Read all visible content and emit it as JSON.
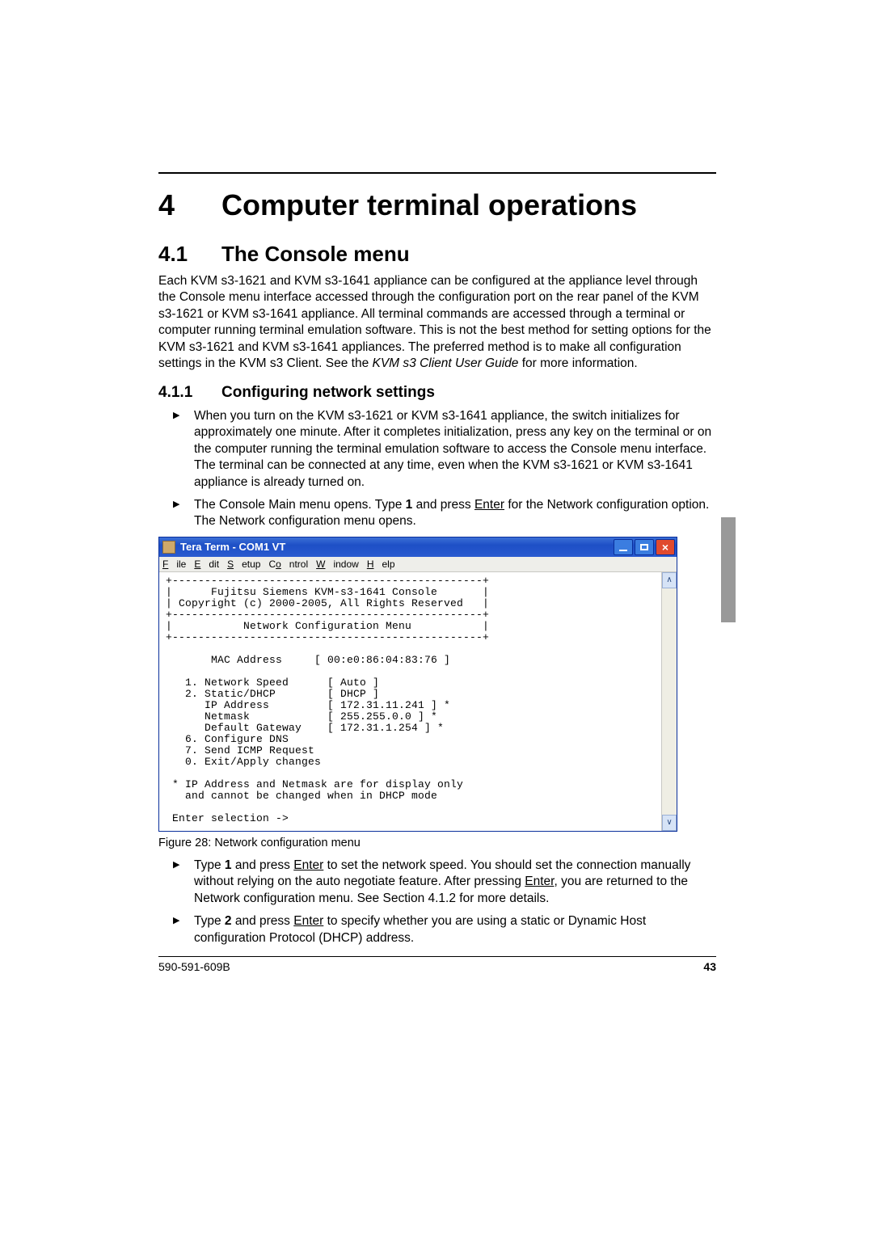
{
  "chapter": {
    "num": "4",
    "title": "Computer terminal operations"
  },
  "section": {
    "num": "4.1",
    "title": "The Console menu",
    "para": "Each KVM s3-1621 and KVM s3-1641 appliance can be configured at the appliance level through the Console menu interface accessed through the configuration port on the rear panel of the KVM s3-1621 or KVM s3-1641 appliance. All terminal commands are accessed through a terminal or computer running terminal emulation software. This is not the best method for setting options for the KVM s3-1621 and KVM s3-1641 appliances. The preferred method is to make all configuration settings in the KVM s3 Client. See the ",
    "para_em": "KVM s3 Client User Guide",
    "para_tail": " for more information."
  },
  "subsection": {
    "num": "4.1.1",
    "title": "Configuring network settings"
  },
  "bullets_top": [
    "When you turn on the KVM s3-1621 or KVM s3-1641 appliance, the switch initializes for approximately one minute. After it completes initialization, press any key on the terminal or on the computer running the terminal emulation software to access the Console menu interface. The terminal can be connected at any time, even when the KVM s3-1621 or KVM s3-1641 appliance is already turned on."
  ],
  "bullet_net": {
    "pre": "The Console Main menu opens. Type ",
    "b1": "1",
    "mid": " and press ",
    "u1": "Enter",
    "tail": " for the Network configuration option. The Network configuration menu opens."
  },
  "terminal": {
    "title": "Tera Term - COM1 VT",
    "menu": {
      "file": "File",
      "edit": "Edit",
      "setup": "Setup",
      "control": "Control",
      "window": "Window",
      "help": "Help"
    },
    "lines": [
      "+------------------------------------------------+",
      "|      Fujitsu Siemens KVM-s3-1641 Console       |",
      "| Copyright (c) 2000-2005, All Rights Reserved   |",
      "+------------------------------------------------+",
      "|           Network Configuration Menu           |",
      "+------------------------------------------------+",
      "",
      "       MAC Address     [ 00:e0:86:04:83:76 ]",
      "",
      "   1. Network Speed      [ Auto ]",
      "   2. Static/DHCP        [ DHCP ]",
      "      IP Address         [ 172.31.11.241 ] *",
      "      Netmask            [ 255.255.0.0 ] *",
      "      Default Gateway    [ 172.31.1.254 ] *",
      "   6. Configure DNS",
      "   7. Send ICMP Request",
      "   0. Exit/Apply changes",
      "",
      " * IP Address and Netmask are for display only",
      "   and cannot be changed when in DHCP mode",
      "",
      " Enter selection ->"
    ]
  },
  "caption": "Figure 28: Network configuration menu",
  "bullets_bottom": {
    "b1_pre": "Type ",
    "b1_b": "1",
    "b1_mid1": " and press ",
    "b1_u1": "Enter",
    "b1_mid2": " to set the network speed. You should set the connection manually without relying on the auto negotiate feature. After pressing ",
    "b1_u2": "Enter",
    "b1_tail": ", you are returned to the Network configuration menu. See Section 4.1.2 for more details.",
    "b2_pre": "Type ",
    "b2_b": "2",
    "b2_mid": " and press ",
    "b2_u": "Enter",
    "b2_tail": " to specify whether you are using a static or Dynamic Host configuration Protocol (DHCP) address."
  },
  "footer": {
    "left": "590-591-609B",
    "right": "43"
  }
}
